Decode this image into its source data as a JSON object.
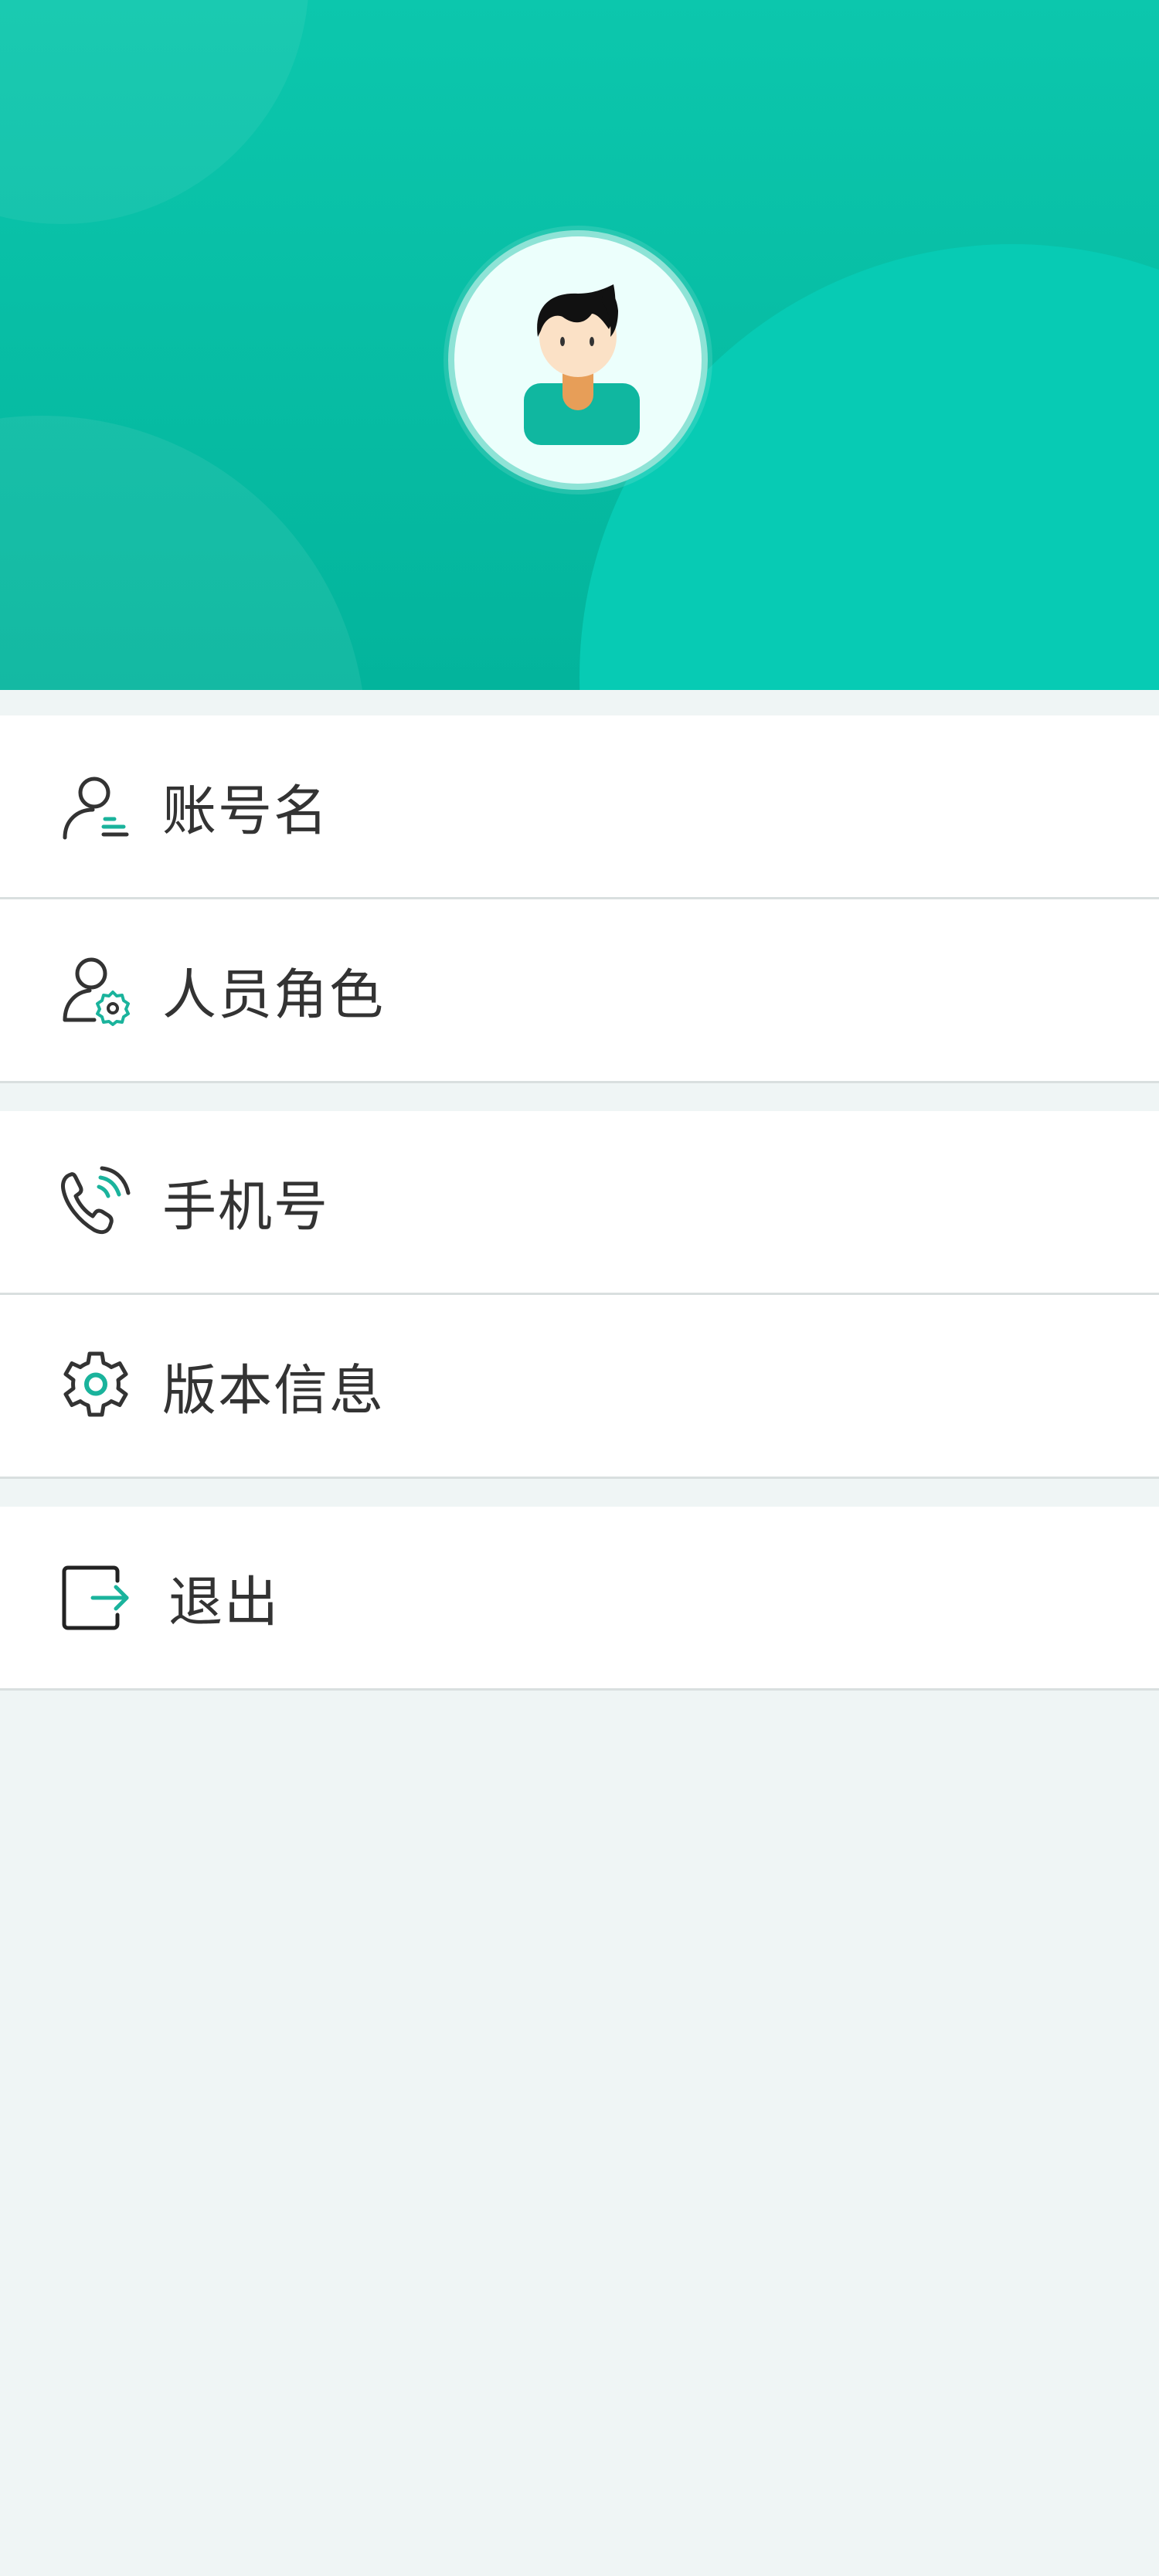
{
  "header": {
    "avatar_alt": "用户头像"
  },
  "menu": {
    "groups": [
      {
        "items": [
          {
            "label": "账号名",
            "icon": "account-name-icon"
          },
          {
            "label": "人员角色",
            "icon": "role-settings-icon"
          }
        ]
      },
      {
        "items": [
          {
            "label": "手机号",
            "icon": "phone-icon"
          },
          {
            "label": "版本信息",
            "icon": "gear-icon"
          }
        ]
      },
      {
        "items": [
          {
            "label": "退出",
            "icon": "logout-icon"
          }
        ]
      }
    ]
  },
  "colors": {
    "brand": "#0cc7ad",
    "accent": "#1ab39c",
    "text": "#333333",
    "background": "#eff5f5"
  }
}
